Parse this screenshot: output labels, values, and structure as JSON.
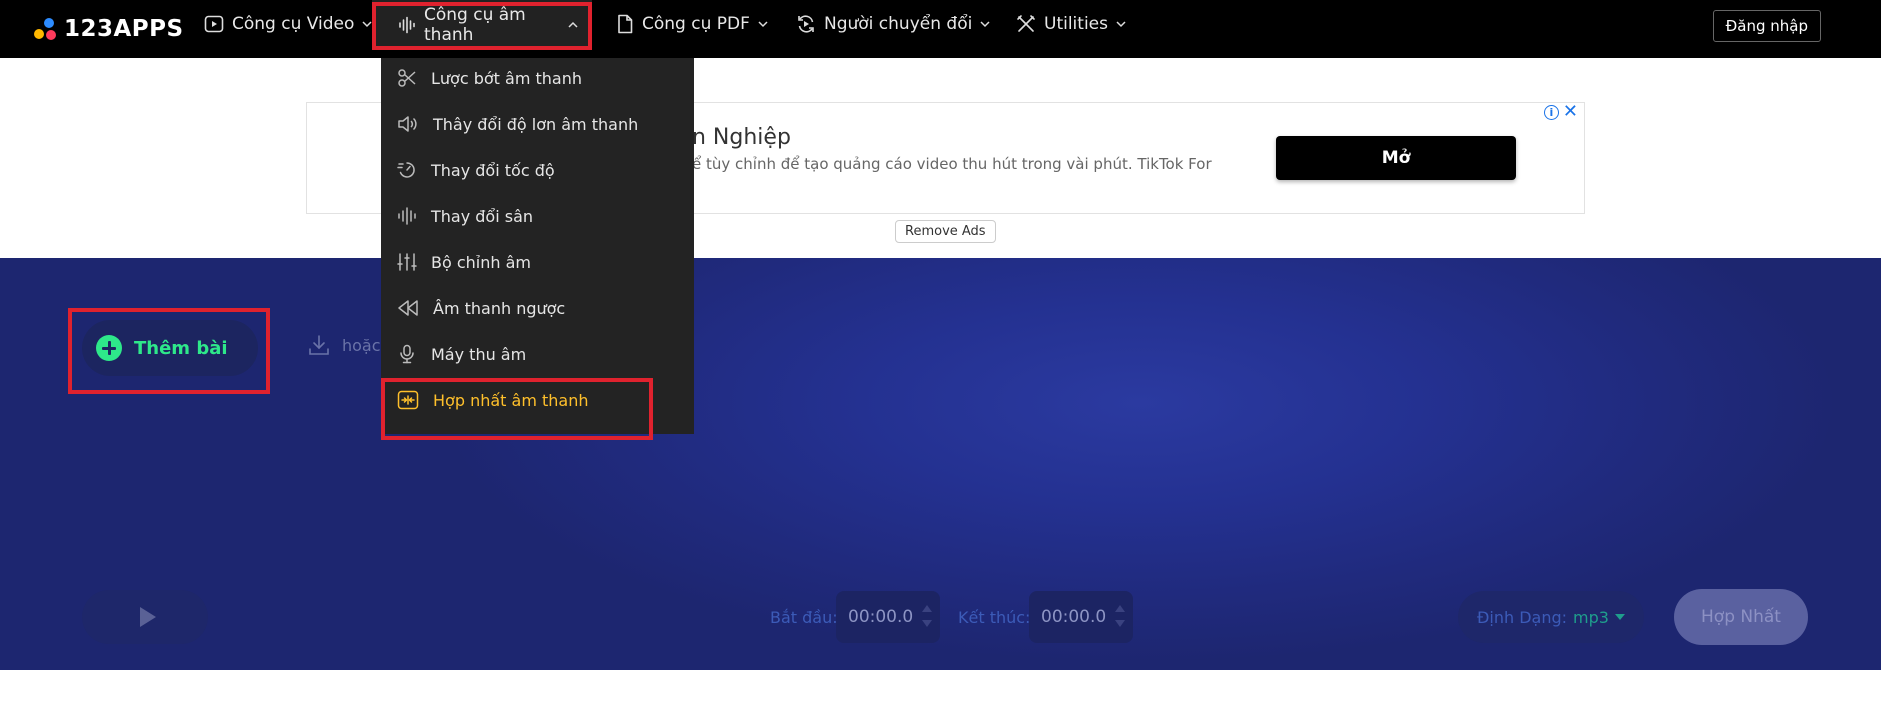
{
  "brand": {
    "logo_text": "123APPS"
  },
  "nav": {
    "video": "Công cụ Video",
    "audio": "Công cụ âm thanh",
    "pdf": "Công cụ PDF",
    "converters": "Người chuyển đổi",
    "utilities": "Utilities",
    "login": "Đăng nhập"
  },
  "ad": {
    "title": "n Nghiệp",
    "description": "ể tùy chỉnh để tạo quảng cáo video thu hút trong vài phút. TikTok For",
    "cta": "Mở",
    "remove_ads": "Remove Ads"
  },
  "dropdown": {
    "items": [
      {
        "label": "Lược bớt âm thanh",
        "icon": "scissors-icon"
      },
      {
        "label": "Thây đổi độ lơn âm thanh",
        "icon": "volume-icon"
      },
      {
        "label": "Thay đổi tốc độ",
        "icon": "speed-icon"
      },
      {
        "label": "Thay đổi sân",
        "icon": "waveform-icon"
      },
      {
        "label": "Bộ chỉnh âm",
        "icon": "equalizer-icon"
      },
      {
        "label": "Âm thanh ngược",
        "icon": "rewind-icon"
      },
      {
        "label": "Máy thu âm",
        "icon": "microphone-icon"
      },
      {
        "label": "Hợp nhất âm thanh",
        "icon": "merge-icon",
        "active": true
      }
    ]
  },
  "tool": {
    "add_label": "Thêm bài",
    "or_text": "hoặc",
    "start_label": "Bắt đầu:",
    "start_value": "00:00.0",
    "end_label": "Kết thúc:",
    "end_value": "00:00.0",
    "format_label": "Định Dạng:",
    "format_value": "mp3",
    "merge_button": "Hợp Nhất"
  },
  "colors": {
    "highlight": "#e0222e",
    "accent_green": "#2ee88a",
    "active_menu": "#ffc02b",
    "tool_bg": "#232f8a"
  }
}
